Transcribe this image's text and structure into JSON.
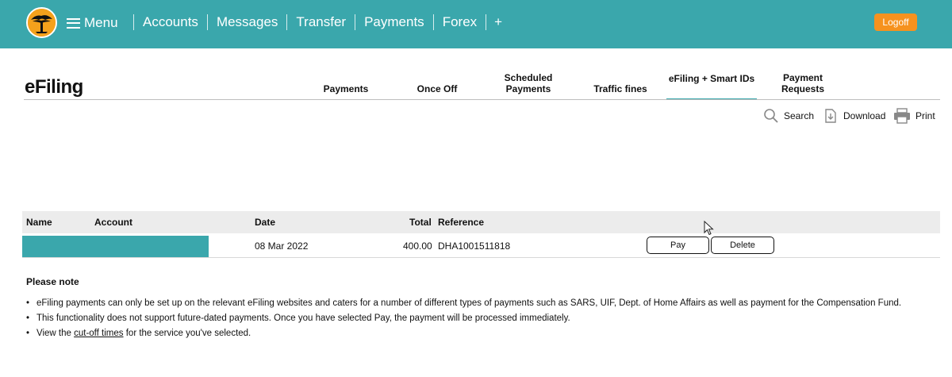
{
  "topbar": {
    "menu_label": "Menu",
    "nav": [
      "Accounts",
      "Messages",
      "Transfer",
      "Payments",
      "Forex",
      "+"
    ],
    "logoff_label": "Logoff",
    "colors": {
      "bar": "#3aa7ac",
      "logoff": "#f6921e"
    }
  },
  "page": {
    "title": "eFiling"
  },
  "tabs": [
    {
      "label": "Payments"
    },
    {
      "label": "Once Off"
    },
    {
      "label": "Scheduled Payments"
    },
    {
      "label": "Traffic fines"
    },
    {
      "label": "eFiling + Smart IDs"
    },
    {
      "label": "Payment Requests"
    }
  ],
  "tools": {
    "search": "Search",
    "download": "Download",
    "print": "Print"
  },
  "table": {
    "headers": {
      "name": "Name",
      "account": "Account",
      "date": "Date",
      "total": "Total",
      "reference": "Reference"
    },
    "rows": [
      {
        "name": "",
        "account": "",
        "date": "08 Mar 2022",
        "total": "400.00",
        "reference": "DHA1001511818",
        "pay_label": "Pay",
        "delete_label": "Delete"
      }
    ]
  },
  "notes": {
    "title": "Please note",
    "items": [
      "eFiling payments can only be set up on the relevant eFiling websites and caters for a number of different types of payments such as SARS, UIF, Dept. of Home Affairs as well as payment for the Compensation Fund.",
      "This functionality does not support future-dated payments. Once you have selected Pay, the payment will be processed immediately."
    ],
    "last_prefix": "View the ",
    "last_link": "cut-off times",
    "last_suffix": " for the service you've selected."
  }
}
